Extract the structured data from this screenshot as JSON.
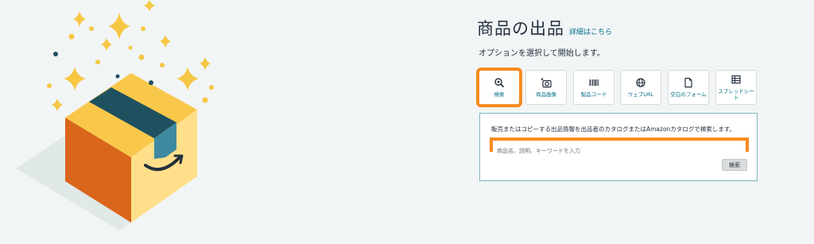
{
  "header": {
    "title": "商品の出品",
    "details_link": "詳細はこちら",
    "subtitle": "オプションを選択して開始します。"
  },
  "tabs": [
    {
      "label": "検索",
      "icon": "search-icon",
      "selected": true
    },
    {
      "label": "商品画像",
      "icon": "camera-sparkle-icon",
      "selected": false
    },
    {
      "label": "製品コード",
      "icon": "barcode-icon",
      "selected": false
    },
    {
      "label": "ウェブURL",
      "icon": "globe-icon",
      "selected": false
    },
    {
      "label": "空白のフォーム",
      "icon": "document-icon",
      "selected": false
    },
    {
      "label": "スプレッドシート",
      "icon": "spreadsheet-icon",
      "selected": false
    }
  ],
  "search": {
    "description": "販売またはコピーする出品情報を出品者のカタログまたはAmazonカタログで検索します。",
    "placeholder": "商品名、説明、キーワードを入力",
    "button_label": "検索"
  },
  "colors": {
    "accent_orange": "#f68b1f",
    "link_teal": "#007185",
    "box_front": "#d9661a",
    "box_side": "#ffdf8a",
    "box_top": "#f9c84a",
    "tape": "#1f5060",
    "sparkle": "#f6c744"
  }
}
